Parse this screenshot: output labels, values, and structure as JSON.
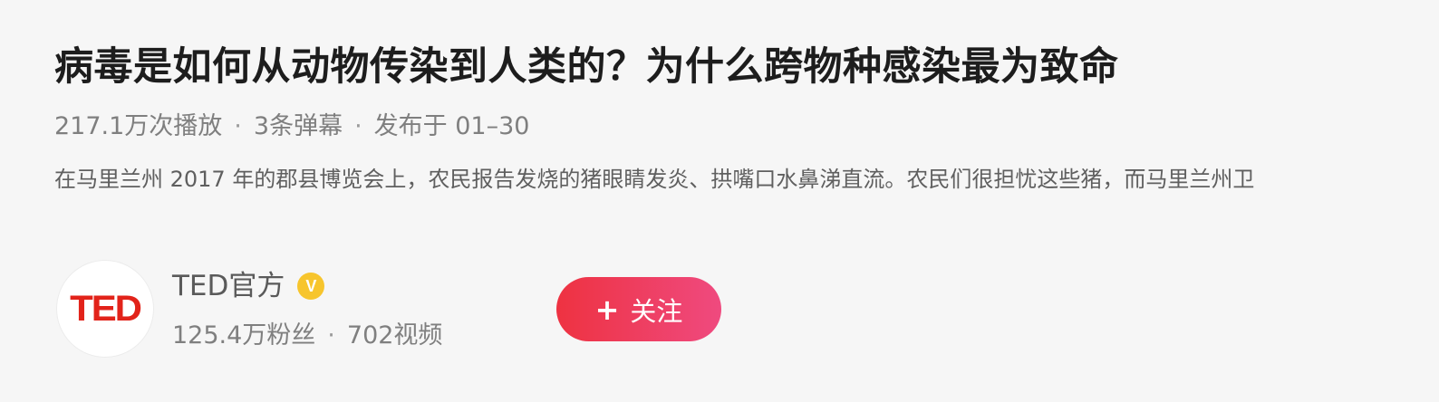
{
  "video": {
    "title": "病毒是如何从动物传染到人类的？为什么跨物种感染最为致命",
    "plays": "217.1万次播放",
    "danmaku": "3条弹幕",
    "published": "发布于 01–30",
    "separator": "·",
    "description": "在马里兰州 2017 年的郡县博览会上，农民报告发烧的猪眼睛发炎、拱嘴口水鼻涕直流。农民们很担忧这些猪，而马里兰州卫"
  },
  "author": {
    "avatar_text": "TED",
    "name": "TED官方",
    "verified_mark": "V",
    "fans": "125.4万粉丝",
    "videos": "702视频",
    "separator": "·"
  },
  "follow_button": {
    "icon": "+",
    "label": "关注"
  },
  "colors": {
    "background": "#f6f6f6",
    "brand_red": "#e2231a",
    "button_gradient_start": "#ee3241",
    "button_gradient_end": "#ef4a7f",
    "verified": "#f7c52d"
  }
}
